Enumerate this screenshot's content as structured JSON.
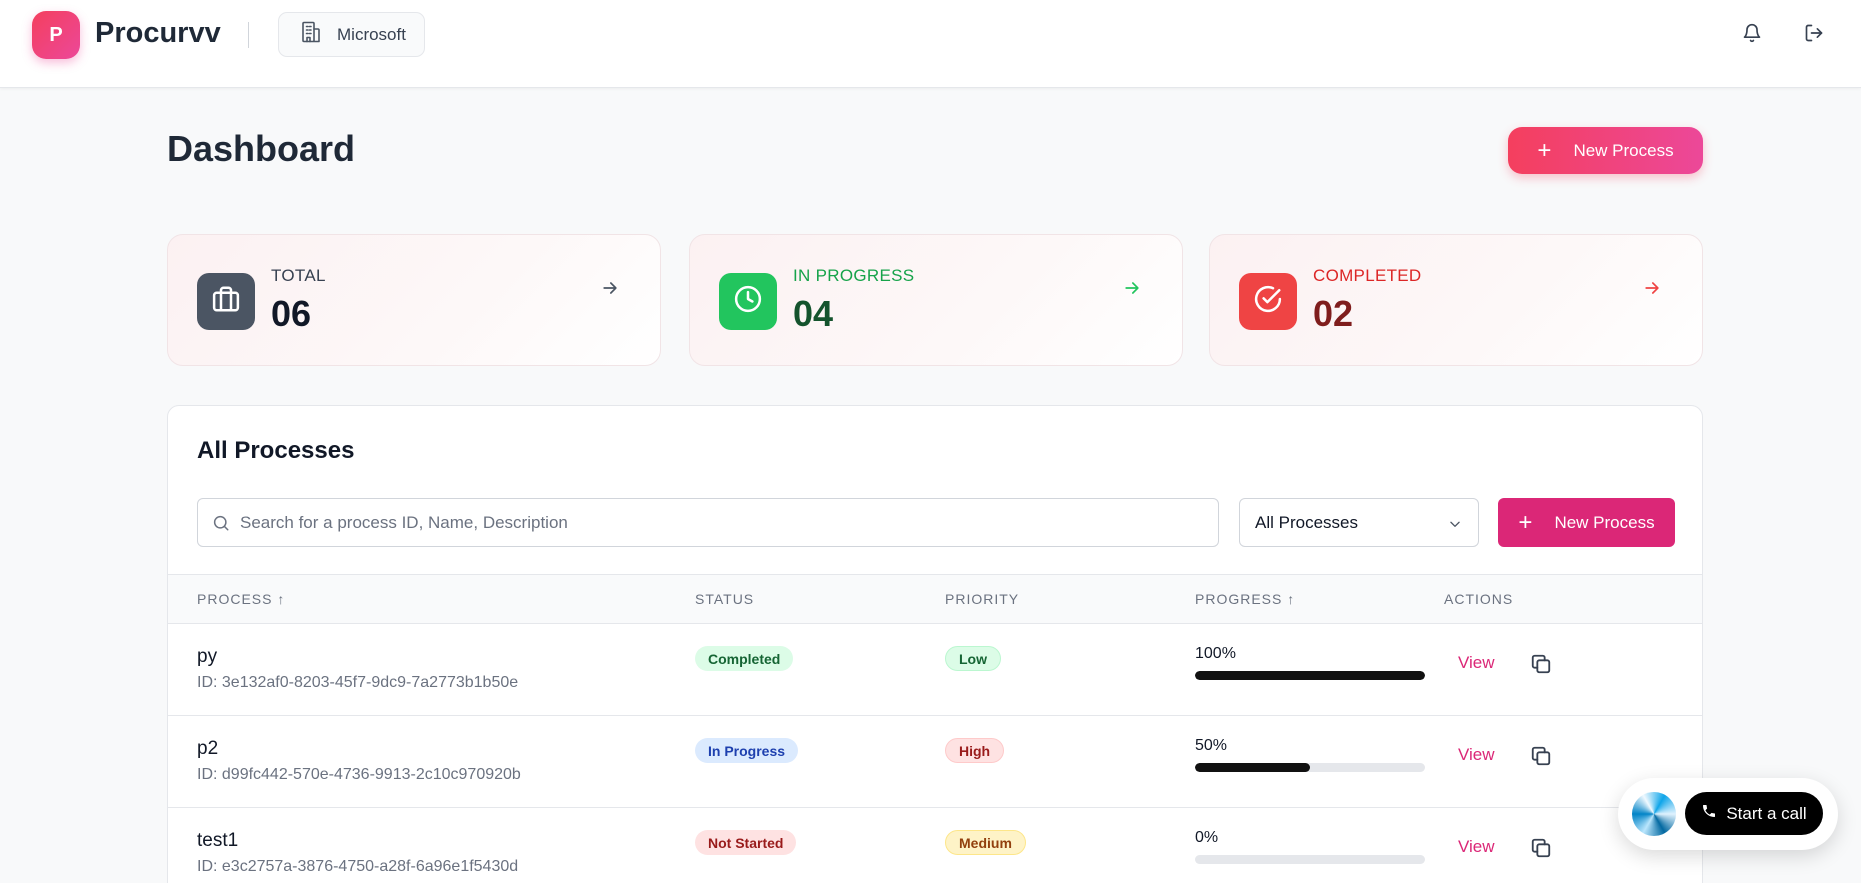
{
  "header": {
    "logo_letter": "P",
    "brand": "Procurvv",
    "org_name": "Microsoft",
    "icons": [
      "building-icon",
      "bell-icon",
      "logout-icon"
    ]
  },
  "page": {
    "title": "Dashboard",
    "new_process_label": "New Process"
  },
  "stats": [
    {
      "label": "TOTAL",
      "value": "06",
      "icon": "briefcase-icon",
      "color": "#4b5563",
      "label_color": "#374151",
      "value_color": "#111827"
    },
    {
      "label": "IN PROGRESS",
      "value": "04",
      "icon": "clock-icon",
      "color": "#22c55e",
      "label_color": "#16a34a",
      "value_color": "#14532d"
    },
    {
      "label": "COMPLETED",
      "value": "02",
      "icon": "check-circle-icon",
      "color": "#ef4444",
      "label_color": "#dc2626",
      "value_color": "#7f1d1d"
    }
  ],
  "processes_panel": {
    "title": "All Processes",
    "search_placeholder": "Search for a process ID, Name, Description",
    "filter_selected": "All Processes",
    "new_process_label": "New Process",
    "columns": [
      "PROCESS ↑",
      "STATUS",
      "PRIORITY",
      "PROGRESS ↑",
      "ACTIONS"
    ],
    "rows": [
      {
        "name": "py",
        "id": "ID: 3e132af0-8203-45f7-9dc9-7a2773b1b50e",
        "status": "Completed",
        "priority": "Low",
        "progress_label": "100%",
        "progress": 100,
        "action": "View"
      },
      {
        "name": "p2",
        "id": "ID: d99fc442-570e-4736-9913-2c10c970920b",
        "status": "In Progress",
        "priority": "High",
        "progress_label": "50%",
        "progress": 50,
        "action": "View"
      },
      {
        "name": "test1",
        "id": "ID: e3c2757a-3876-4750-a28f-6a96e1f5430d",
        "status": "Not Started",
        "priority": "Medium",
        "progress_label": "0%",
        "progress": 0,
        "action": "View"
      }
    ]
  },
  "call_widget": {
    "label": "Start a call"
  },
  "colors": {
    "accent": "#ec4899",
    "accent_dark": "#db2777"
  }
}
